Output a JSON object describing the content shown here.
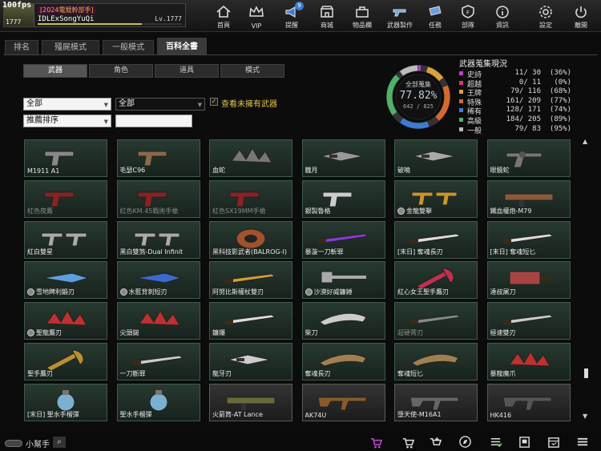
{
  "fps": "100fps",
  "profile": {
    "rank_number": "1777",
    "clan_tag": "[2024電競幹部手]",
    "player_name": "IDLExSongYuQi",
    "level": "Lv.1777",
    "xp_progress": 0.72
  },
  "nav": [
    {
      "label": "首頁",
      "icon": "home-icon"
    },
    {
      "label": "VIP",
      "icon": "crown-icon"
    },
    {
      "label": "提醒",
      "icon": "megaphone-icon",
      "badge": "9"
    },
    {
      "label": "商城",
      "icon": "shop-icon"
    },
    {
      "label": "物品欄",
      "icon": "bag-icon"
    },
    {
      "label": "武器製作",
      "icon": "gun-craft-icon"
    },
    {
      "label": "任務",
      "icon": "ticket-icon"
    },
    {
      "label": "部隊",
      "icon": "shield-icon"
    },
    {
      "label": "資訊",
      "icon": "info-icon"
    },
    {
      "label": "設定",
      "icon": "gear-icon"
    },
    {
      "label": "離開",
      "icon": "power-icon"
    }
  ],
  "main_tabs": [
    {
      "label": "排名",
      "active": false
    },
    {
      "label": "殭屍模式",
      "active": false
    },
    {
      "label": "一般模式",
      "active": false
    },
    {
      "label": "百科全書",
      "active": true
    }
  ],
  "sub_tabs": [
    {
      "label": "武器",
      "active": true
    },
    {
      "label": "角色",
      "active": false
    },
    {
      "label": "道具",
      "active": false
    },
    {
      "label": "模式",
      "active": false
    }
  ],
  "filters": {
    "category_1": "全部",
    "category_2": "全部",
    "sort": "推薦排序",
    "search_value": "",
    "owned_only_label": "查看未擁有武器",
    "owned_only_checked": true
  },
  "collection": {
    "title": "武器蒐集現況",
    "ring_title": "全部蒐集",
    "ring_percent": "77.82%",
    "ring_count": "642 / 825",
    "rows": [
      {
        "name": "史詩",
        "count": "11/ 30",
        "pct": "(36%)",
        "color": "#c33bd6",
        "value": 0.36
      },
      {
        "name": "超越",
        "count": "0/ 11",
        "pct": "(0%)",
        "color": "#d4367a",
        "value": 0.0
      },
      {
        "name": "王牌",
        "count": "79/ 116",
        "pct": "(68%)",
        "color": "#d8a338",
        "value": 0.68
      },
      {
        "name": "特殊",
        "count": "161/ 209",
        "pct": "(77%)",
        "color": "#d46a2d",
        "value": 0.77
      },
      {
        "name": "稀有",
        "count": "128/ 171",
        "pct": "(74%)",
        "color": "#3d7bd6",
        "value": 0.74
      },
      {
        "name": "高級",
        "count": "184/ 205",
        "pct": "(89%)",
        "color": "#4fb06a",
        "value": 0.89
      },
      {
        "name": "一般",
        "count": "79/ 83",
        "pct": "(95%)",
        "color": "#bbbbbb",
        "value": 0.95
      }
    ]
  },
  "weapons": [
    {
      "name": "M1911 A1",
      "owned": false,
      "kind": "pistol",
      "color": "#888"
    },
    {
      "name": "毛瑟C96",
      "owned": false,
      "kind": "pistol",
      "color": "#8a6a4a"
    },
    {
      "name": "血蛇",
      "owned": false,
      "kind": "claw",
      "color": "#777"
    },
    {
      "name": "朧月",
      "owned": false,
      "kind": "kunai",
      "color": "#999"
    },
    {
      "name": "破曉",
      "owned": false,
      "kind": "kunai",
      "color": "#aaa"
    },
    {
      "name": "眼鏡蛇",
      "owned": false,
      "kind": "revolver",
      "color": "#777"
    },
    {
      "name": "紅色夜鷹",
      "owned": false,
      "kind": "pistol",
      "color": "#8a2222",
      "dim": true
    },
    {
      "name": "紅色KM.45戰術手槍",
      "owned": false,
      "kind": "pistol",
      "color": "#8a2222",
      "dim": true
    },
    {
      "name": "紅色SX19MM手槍",
      "owned": false,
      "kind": "pistol",
      "color": "#8a2222",
      "dim": true
    },
    {
      "name": "銀製魯格",
      "owned": false,
      "kind": "pistol",
      "color": "#ccc"
    },
    {
      "name": "金龍雙擊",
      "owned": false,
      "kind": "dual",
      "color": "#c8962a",
      "coin": true
    },
    {
      "name": "鐵血權炮-M79",
      "owned": false,
      "kind": "launcher",
      "color": "#8a5a3a"
    },
    {
      "name": "紅白雙星",
      "owned": false,
      "kind": "dual",
      "color": "#aaa"
    },
    {
      "name": "黑白雙煞-Dual Infinit",
      "owned": false,
      "kind": "dual",
      "color": "#aaa"
    },
    {
      "name": "黑科技影武者(BALROG-I)",
      "owned": false,
      "kind": "gauntlet",
      "color": "#a0522d"
    },
    {
      "name": "暴漩一刀斬罪",
      "owned": false,
      "kind": "blade",
      "color": "#8a3ad6"
    },
    {
      "name": "[末日] 奪魂長刃",
      "owned": false,
      "kind": "blade",
      "color": "#ddd"
    },
    {
      "name": "[末日] 奪魂短匕",
      "owned": false,
      "kind": "blade",
      "color": "#ddd"
    },
    {
      "name": "雪地睥利鍛刃",
      "owned": false,
      "kind": "knife",
      "color": "#5aa0e0",
      "coin": true
    },
    {
      "name": "水藍背刺短刃",
      "owned": false,
      "kind": "knife",
      "color": "#3a6ad0",
      "coin": true
    },
    {
      "name": "阿努比斯權杖雙刃",
      "owned": false,
      "kind": "blade",
      "color": "#d0a030"
    },
    {
      "name": "沙漠好威鐮錘",
      "owned": false,
      "kind": "hammer",
      "color": "#aaa",
      "coin": true
    },
    {
      "name": "紅心女王聖手鷹刃",
      "owned": false,
      "kind": "axe",
      "color": "#c03050"
    },
    {
      "name": "達叔屠刀",
      "owned": false,
      "kind": "cleaver",
      "color": "#aa4444"
    },
    {
      "name": "聖龍鷹刃",
      "owned": false,
      "kind": "claw",
      "color": "#c03030",
      "coin": true
    },
    {
      "name": "尖頭鎚",
      "owned": false,
      "kind": "claw",
      "color": "#c03030"
    },
    {
      "name": "鐮爆",
      "owned": false,
      "kind": "blade",
      "color": "#ddd"
    },
    {
      "name": "柴刀",
      "owned": false,
      "kind": "machete",
      "color": "#ccc"
    },
    {
      "name": "超硬菁刃",
      "owned": false,
      "kind": "blade",
      "color": "#888",
      "dim": true
    },
    {
      "name": "極速雙刃",
      "owned": false,
      "kind": "blade",
      "color": "#ccc"
    },
    {
      "name": "聖手鷹刃",
      "owned": false,
      "kind": "axe",
      "color": "#b89030"
    },
    {
      "name": "一刀斷罪",
      "owned": false,
      "kind": "blade",
      "color": "#ccc"
    },
    {
      "name": "龍牙刃",
      "owned": false,
      "kind": "kunai",
      "color": "#ccc"
    },
    {
      "name": "奪魂長刃",
      "owned": false,
      "kind": "machete",
      "color": "#a08050"
    },
    {
      "name": "奪魂短匕",
      "owned": false,
      "kind": "machete",
      "color": "#a08050"
    },
    {
      "name": "暴龍魔爪",
      "owned": false,
      "kind": "claw",
      "color": "#c03030"
    },
    {
      "name": "[末日] 聖水手榴彈",
      "owned": false,
      "kind": "grenade",
      "color": "#7ab0d0"
    },
    {
      "name": "聖水手榴彈",
      "owned": false,
      "kind": "grenade",
      "color": "#7ab0d0"
    },
    {
      "name": "火箭筒-AT Lance",
      "owned": true,
      "kind": "launcher",
      "color": "#6a6a3a"
    },
    {
      "name": "AK74U",
      "owned": true,
      "kind": "rifle",
      "color": "#8a5a2a"
    },
    {
      "name": "墮天使-M16A1",
      "owned": true,
      "kind": "rifle",
      "color": "#666"
    },
    {
      "name": "HK416",
      "owned": true,
      "kind": "rifle",
      "color": "#555"
    }
  ],
  "helper": {
    "label": "小幫手"
  },
  "bottom_icons": [
    "wishlist-icon",
    "cart-icon",
    "cart-plus-icon",
    "compass-icon",
    "checklist-icon",
    "bookmark-icon",
    "calendar-icon",
    "menu-icon"
  ]
}
